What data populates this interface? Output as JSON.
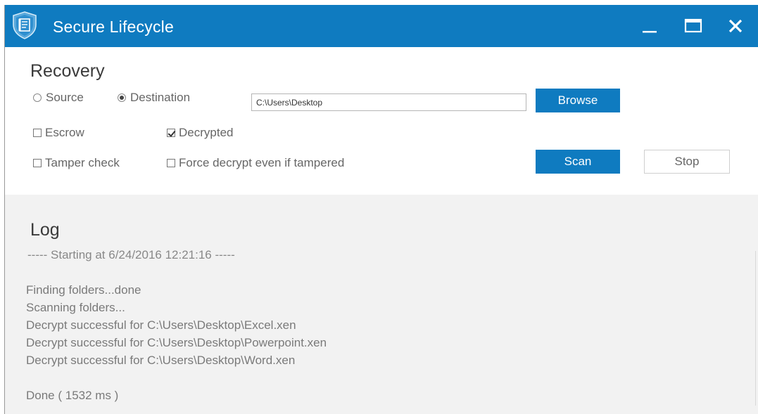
{
  "window": {
    "title": "Secure Lifecycle",
    "controls": {
      "minimize_icon": "minimize-icon",
      "maximize_icon": "maximize-icon",
      "close_icon": "close-icon"
    },
    "accent_color": "#0f7bc0"
  },
  "recovery": {
    "title": "Recovery",
    "source_label": "Source",
    "destination_label": "Destination",
    "selected_mode": "Destination",
    "path_value": "C:\\Users\\Desktop",
    "browse_label": "Browse",
    "escrow_label": "Escrow",
    "escrow_checked": false,
    "decrypted_label": "Decrypted",
    "decrypted_checked": true,
    "tamper_label": "Tamper check",
    "tamper_checked": false,
    "force_label": "Force decrypt even if tampered",
    "force_checked": false,
    "scan_label": "Scan",
    "stop_label": "Stop"
  },
  "log": {
    "title": "Log",
    "header": "----- Starting at 6/24/2016 12:21:16 -----",
    "lines": [
      "Finding folders...done",
      "Scanning folders...",
      "Decrypt successful for C:\\Users\\Desktop\\Excel.xen",
      "Decrypt successful for C:\\Users\\Desktop\\Powerpoint.xen",
      "Decrypt successful for C:\\Users\\Desktop\\Word.xen"
    ],
    "done": "Done ( 1532 ms )"
  }
}
